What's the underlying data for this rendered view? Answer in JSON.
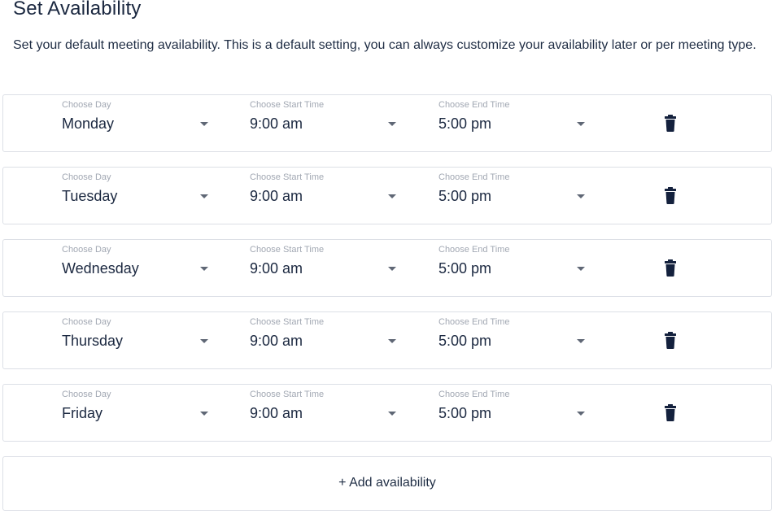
{
  "header": {
    "title": "Set Availability",
    "description": "Set your default meeting availability. This is a default setting, you can always customize your availability later or per meeting type."
  },
  "labels": {
    "day": "Choose Day",
    "start": "Choose Start Time",
    "end": "Choose End Time"
  },
  "rows": [
    {
      "day": "Monday",
      "start": "9:00 am",
      "end": "5:00 pm"
    },
    {
      "day": "Tuesday",
      "start": "9:00 am",
      "end": "5:00 pm"
    },
    {
      "day": "Wednesday",
      "start": "9:00 am",
      "end": "5:00 pm"
    },
    {
      "day": "Thursday",
      "start": "9:00 am",
      "end": "5:00 pm"
    },
    {
      "day": "Friday",
      "start": "9:00 am",
      "end": "5:00 pm"
    }
  ],
  "add_button": {
    "label": "+ Add availability"
  },
  "icons": {
    "dropdown": "chevron-down-icon",
    "delete": "trash-icon"
  },
  "colors": {
    "text_primary": "#1b2840",
    "label_muted": "#a2a8b3",
    "border": "#dcdfe6",
    "caret": "#5f6775"
  }
}
